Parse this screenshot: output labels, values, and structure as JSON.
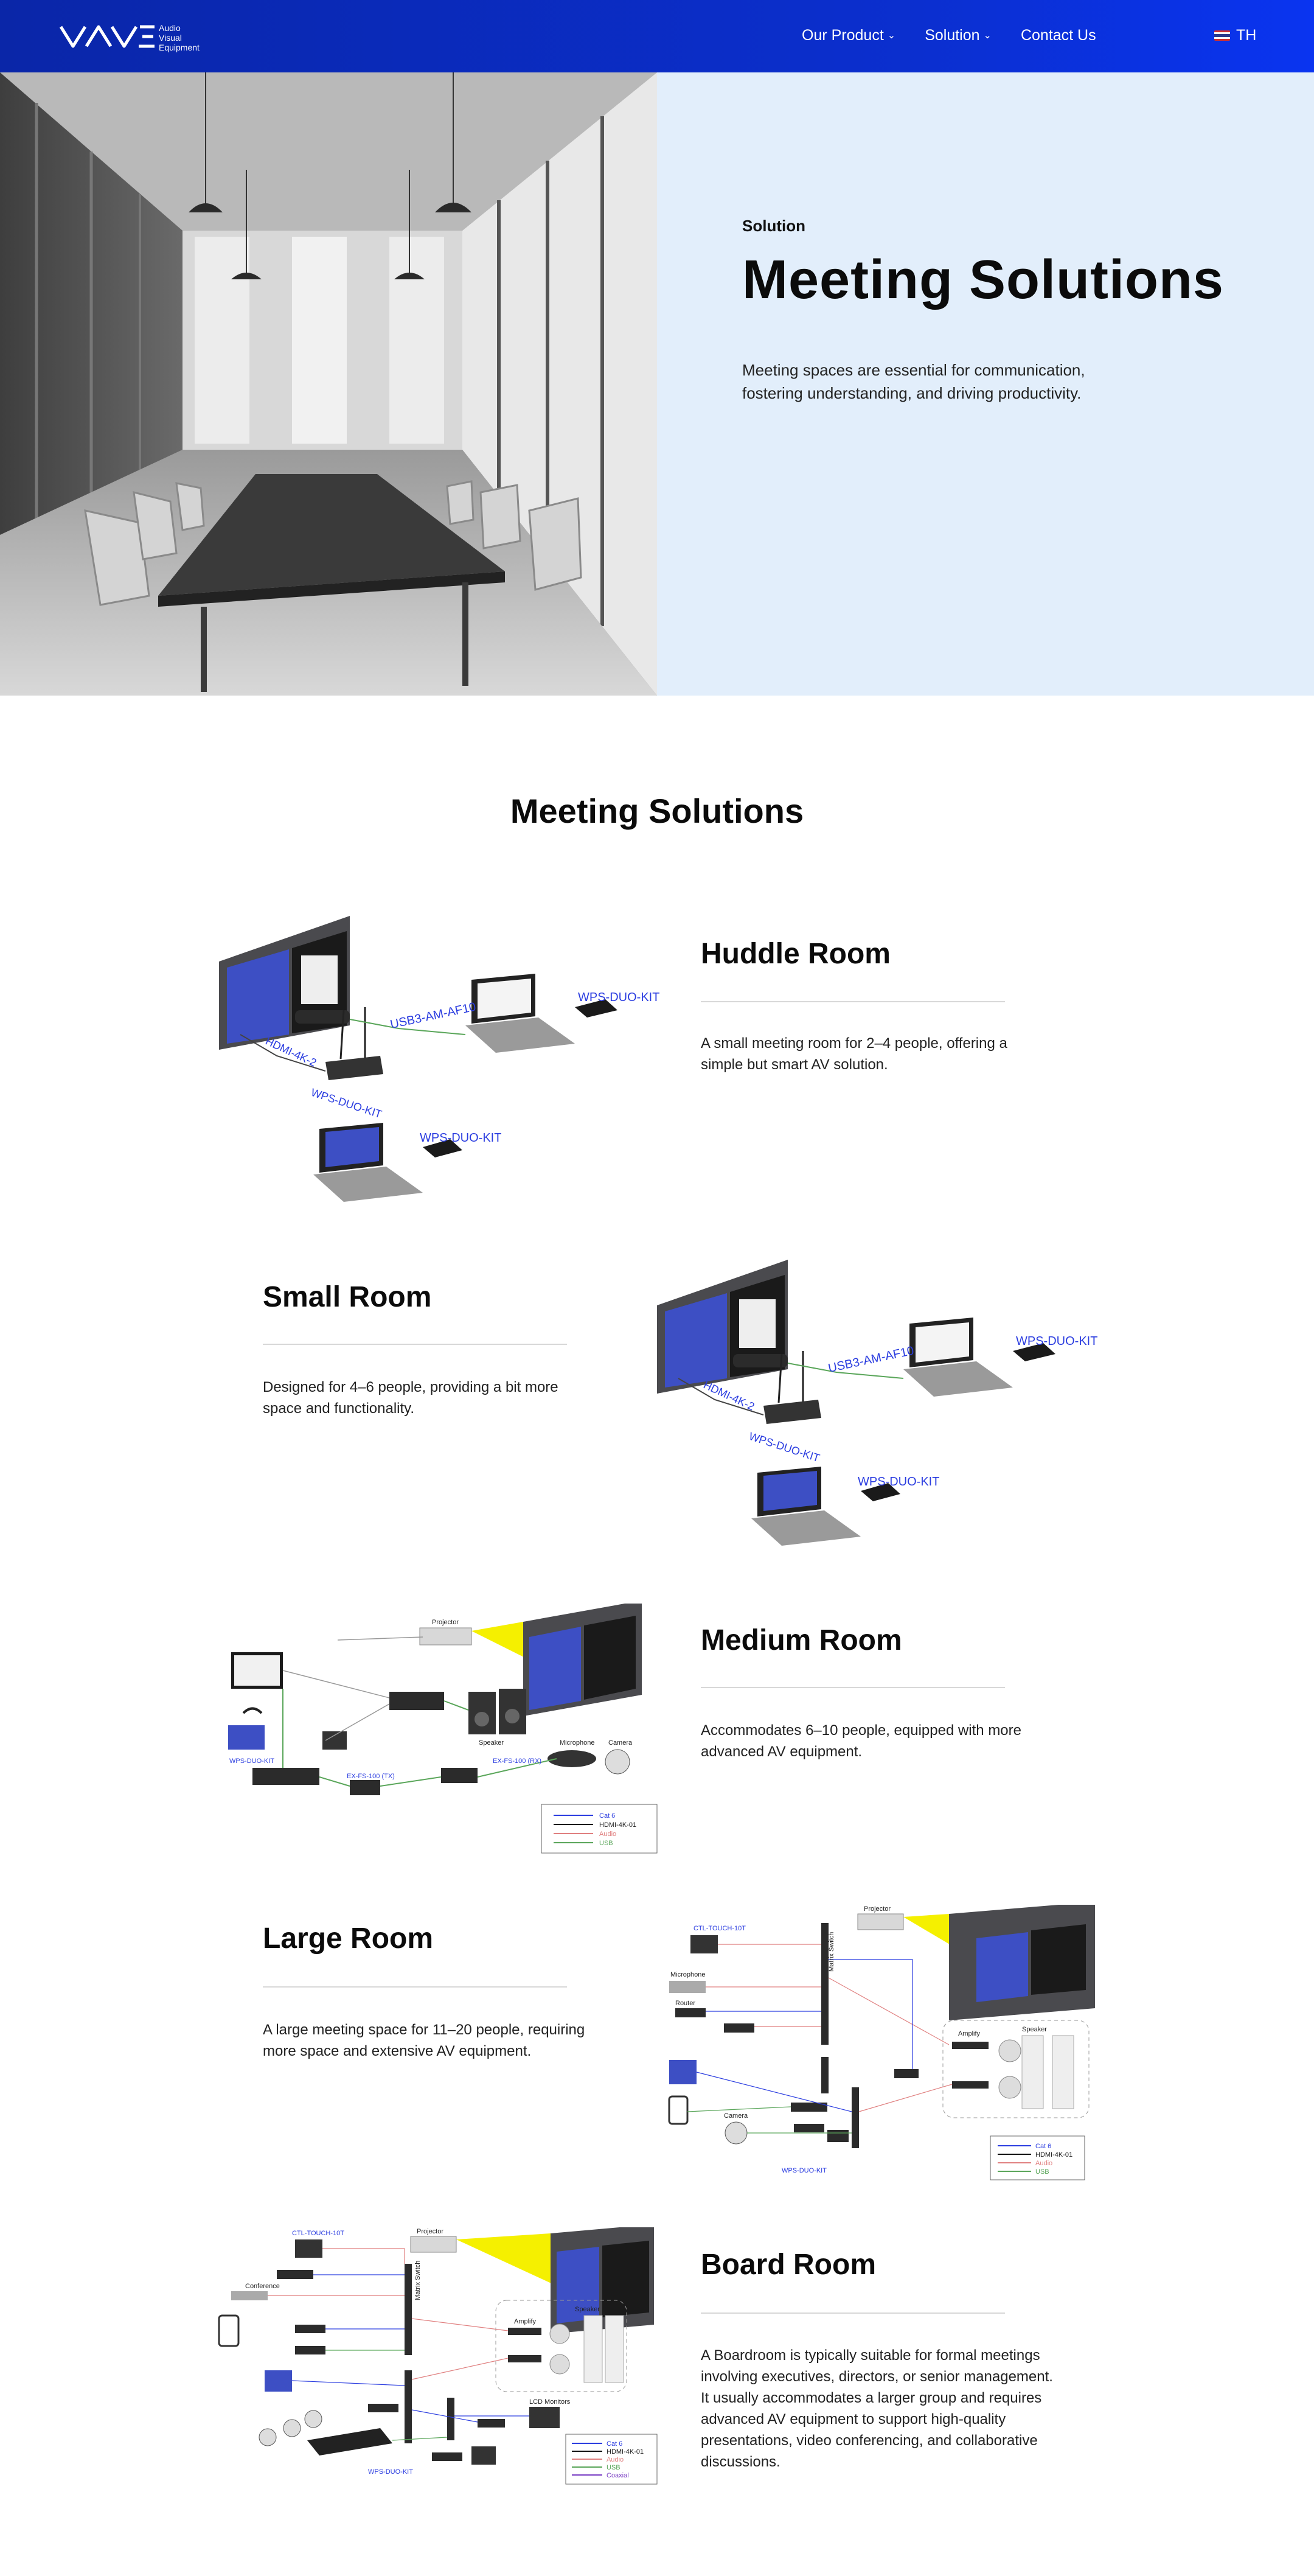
{
  "nav": {
    "logo_text": [
      "Audio",
      "Visual",
      "Equipment"
    ],
    "links": [
      {
        "label": "Our Product",
        "has_dropdown": true
      },
      {
        "label": "Solution",
        "has_dropdown": true
      },
      {
        "label": "Contact Us",
        "has_dropdown": false
      }
    ],
    "language": "TH",
    "colors": {
      "nav_bg": "#0b2fcf",
      "hero_panel": "#e2eefb",
      "accent_label": "#2b3de0"
    }
  },
  "hero": {
    "eyebrow": "Solution",
    "title": "Meeting Solutions",
    "description": "Meeting spaces are essential for communication, fostering understanding, and driving productivity."
  },
  "section": {
    "title": "Meeting Solutions"
  },
  "rooms": [
    {
      "title": "Huddle Room",
      "description": "A small meeting room for 2–4 people, offering a simple but smart AV solution.",
      "diagram_labels": [
        "USB3-AM-AF10",
        "WPS-DUO-KIT",
        "HDMI-4K-2",
        "WPS-DUO-KIT",
        "WPS-DUO-KIT"
      ]
    },
    {
      "title": "Small Room",
      "description": "Designed for 4–6 people, providing a bit more space and functionality.",
      "diagram_labels": [
        "USB3-AM-AF10",
        "WPS-DUO-KIT",
        "HDMI-4K-2",
        "WPS-DUO-KIT",
        "WPS-DUO-KIT"
      ]
    },
    {
      "title": "Medium Room",
      "description": "Accommodates 6–10 people, equipped with more advanced AV equipment.",
      "diagram_labels": [
        "Projector",
        "Speaker",
        "Microphone",
        "Camera",
        "WPS-DUO-KIT",
        "EX-FS-100 (TX)",
        "EX-FS-100 (RX)"
      ],
      "legend": [
        "Cat 6",
        "HDMI-4K-01",
        "Audio",
        "USB"
      ]
    },
    {
      "title": "Large Room",
      "description": "A large meeting space for 11–20 people, requiring more space and extensive AV equipment.",
      "diagram_labels": [
        "Projector",
        "CTL-TOUCH-10T",
        "Microphone",
        "Router",
        "Camera",
        "Amplify",
        "Speaker",
        "Matrix Switch",
        "WPS-DUO-KIT"
      ],
      "legend": [
        "Cat 6",
        "HDMI-4K-01",
        "Audio",
        "USB"
      ]
    },
    {
      "title": "Board Room",
      "description": "A Boardroom is typically suitable for formal meetings involving executives, directors, or senior management. It usually accommodates a larger group and requires advanced AV equipment to support high-quality presentations, video conferencing, and collaborative discussions.",
      "diagram_labels": [
        "Projector",
        "CTL-TOUCH-10T",
        "Conference",
        "Amplify",
        "Speaker",
        "LCD Monitors",
        "Matrix Switch",
        "WPS-DUO-KIT"
      ],
      "legend": [
        "Cat 6",
        "HDMI-4K-01",
        "Audio",
        "USB",
        "Coaxial"
      ]
    }
  ]
}
